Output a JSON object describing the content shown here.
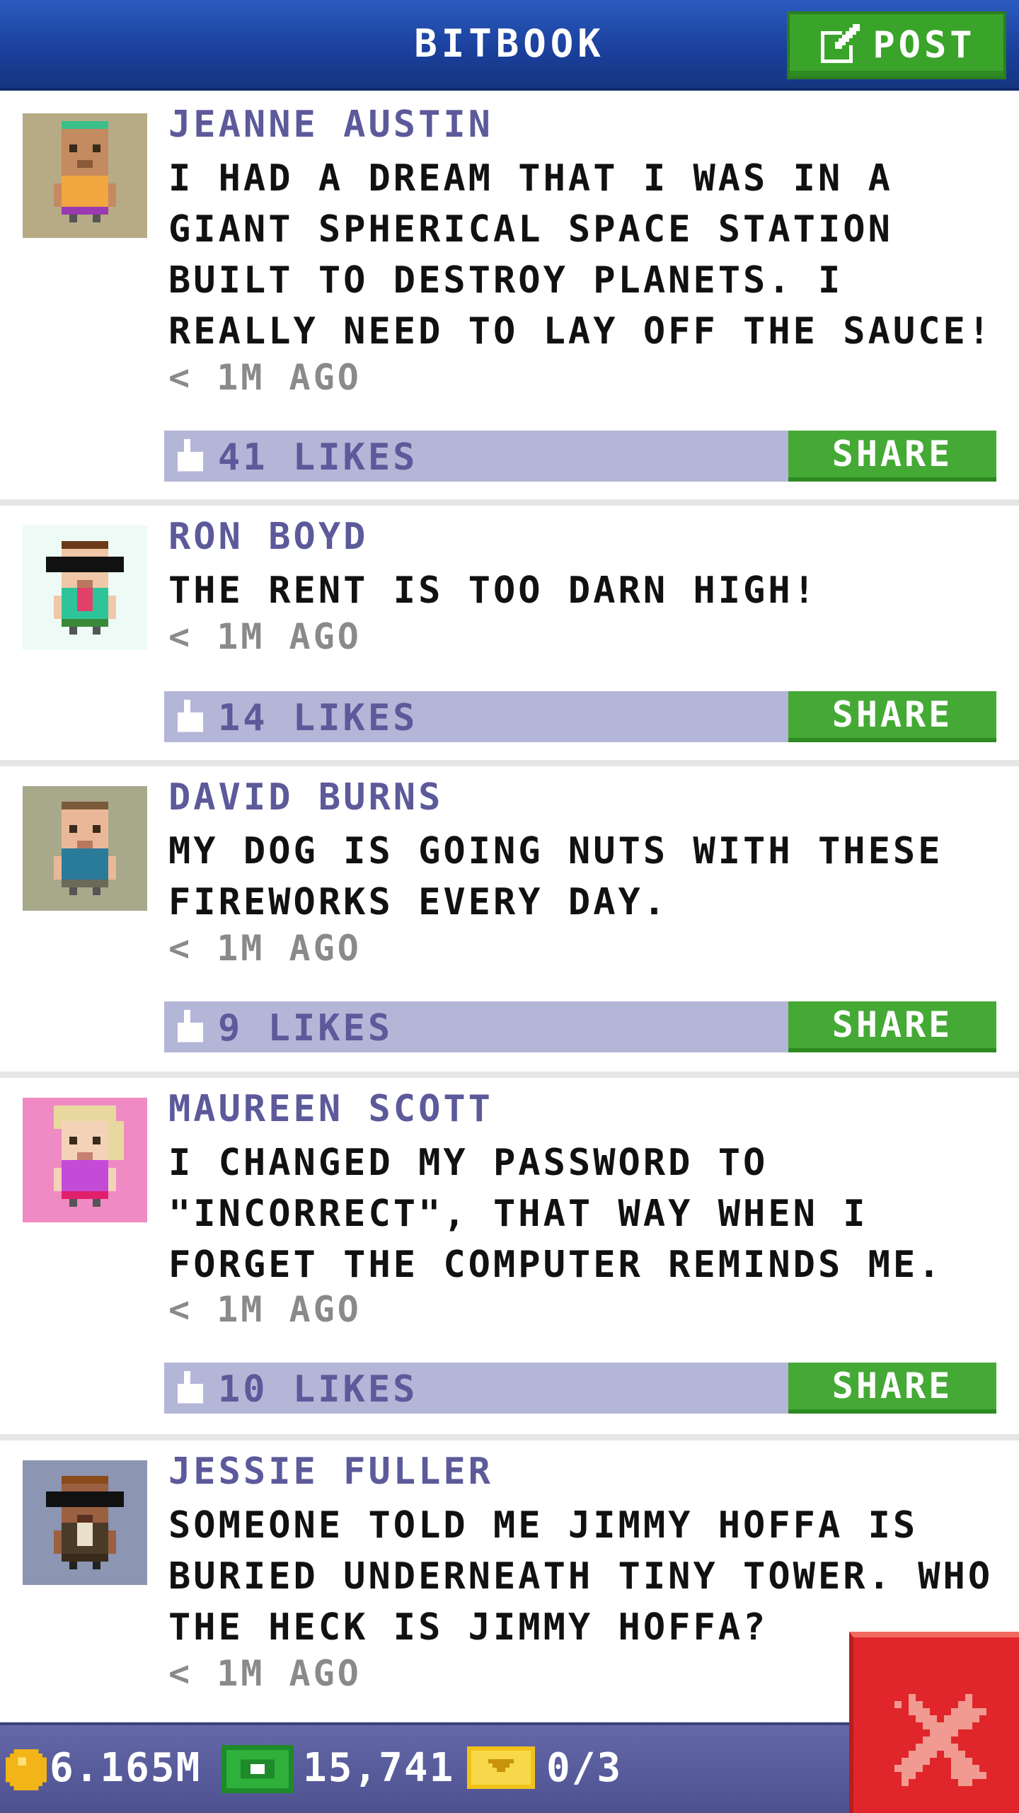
{
  "header": {
    "title": "BITBOOK",
    "post_label": "POST"
  },
  "posts": [
    {
      "author": "JEANNE AUSTIN",
      "message": "I HAD A DREAM THAT I WAS IN A GIANT SPHERICAL SPACE STATION BUILT TO DESTROY PLANETS. I REALLY NEED TO LAY OFF THE SAUCE!",
      "time": "< 1M AGO",
      "likes": "41 LIKES",
      "share_label": "SHARE",
      "avatar_bg": "#b7ab86"
    },
    {
      "author": "RON BOYD",
      "message": "THE RENT IS TOO DARN HIGH!",
      "time": "< 1M AGO",
      "likes": "14 LIKES",
      "share_label": "SHARE",
      "avatar_bg": "#eefaf6"
    },
    {
      "author": "DAVID BURNS",
      "message": "MY DOG IS GOING NUTS WITH THESE FIREWORKS EVERY DAY.",
      "time": "< 1M AGO",
      "likes": "9 LIKES",
      "share_label": "SHARE",
      "avatar_bg": "#a8a98a"
    },
    {
      "author": "MAUREEN SCOTT",
      "message": "I CHANGED MY PASSWORD TO \"INCORRECT\", THAT WAY WHEN I FORGET THE COMPUTER REMINDS ME.",
      "time": "< 1M AGO",
      "likes": "10 LIKES",
      "share_label": "SHARE",
      "avatar_bg": "#f08ac4"
    },
    {
      "author": "JESSIE FULLER",
      "message": "SOMEONE TOLD ME JIMMY HOFFA IS BURIED UNDERNEATH TINY TOWER. WHO THE HECK IS JIMMY HOFFA?",
      "time": "< 1M AGO",
      "avatar_bg": "#8c95b2"
    }
  ],
  "footer": {
    "coins": "6.165M",
    "bux": "15,741",
    "tickets": "0/3"
  },
  "colors": {
    "header": "#1a3f9a",
    "accent_green": "#45a935",
    "likes_bar": "#b4b6d8",
    "author_text": "#5c5a9a",
    "close_red": "#e0262a"
  }
}
